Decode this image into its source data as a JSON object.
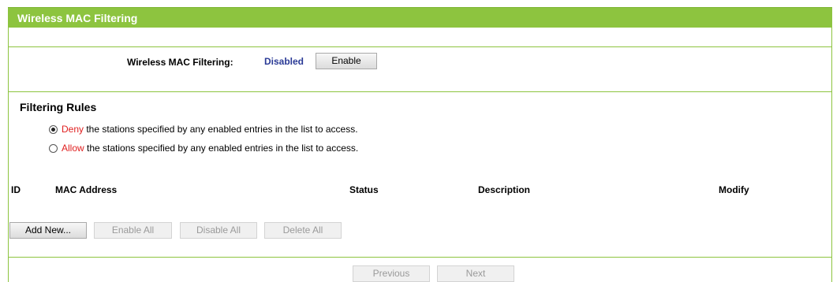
{
  "header": {
    "title": "Wireless MAC Filtering"
  },
  "mac_filtering": {
    "label": "Wireless MAC Filtering:",
    "status": "Disabled",
    "enable_button": "Enable"
  },
  "filtering_rules": {
    "title": "Filtering Rules",
    "deny": {
      "keyword": "Deny",
      "text": " the stations specified by any enabled entries in the list to access.",
      "checked": true
    },
    "allow": {
      "keyword": "Allow",
      "text": " the stations specified by any enabled entries in the list to access.",
      "checked": false
    }
  },
  "table": {
    "columns": [
      "ID",
      "MAC Address",
      "Status",
      "Description",
      "Modify"
    ]
  },
  "actions": {
    "add_new": "Add New...",
    "enable_all": "Enable All",
    "disable_all": "Disable All",
    "delete_all": "Delete All"
  },
  "pagination": {
    "previous": "Previous",
    "next": "Next"
  },
  "colors": {
    "accent_green": "#8dc43f",
    "status_blue": "#2a3a96",
    "keyword_red": "#e02020"
  }
}
